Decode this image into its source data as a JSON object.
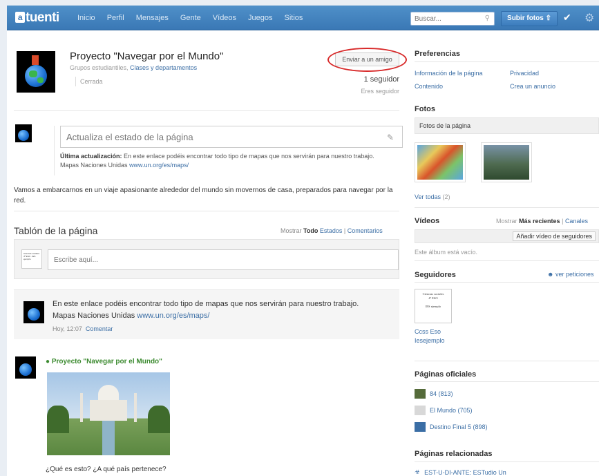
{
  "topbar": {
    "logo_box": "a",
    "logo_text": "tuenti",
    "nav": [
      "Inicio",
      "Perfil",
      "Mensajes",
      "Gente",
      "Vídeos",
      "Juegos",
      "Sitios"
    ],
    "search_placeholder": "Buscar...",
    "upload_label": "Subir fotos ⇧",
    "check_glyph": "✔",
    "gear_glyph": "⚙"
  },
  "page": {
    "title": "Proyecto \"Navegar por el Mundo\"",
    "subtitle_prefix": "Grupos estudiantiles, ",
    "subtitle_link": "Clases y departamentos",
    "closed": "Cerrada",
    "send_button": "Enviar a un amigo",
    "followers": "1 seguidor",
    "is_follower": "Eres seguidor"
  },
  "status": {
    "placeholder": "Actualiza el estado de la página",
    "last_update_label": "Última actualización:",
    "last_update_text": " En este enlace podéis encontrar todo tipo de mapas que nos servirán para nuestro trabajo.",
    "last_update_line2": "Mapas Naciones Unidas ",
    "last_update_link": "www.un.org/es/maps/"
  },
  "description": "Vamos a embarcarnos en un viaje apasionante alrededor del mundo sin movernos de casa, preparados para navegar por la red.",
  "wall": {
    "title": "Tablón de la página",
    "filter_label": "Mostrar ",
    "filter_all": "Todo",
    "filter_states": "Estados",
    "filter_comments": "Comentarios",
    "input_placeholder": "Escribe aquí...",
    "mini_avatar_text": "Ciencias sociales 4º ESO · IES ejemplo"
  },
  "post1": {
    "text_line1": "En este enlace podéis encontrar todo tipo de mapas que nos servirán para nuestro trabajo.",
    "text_line2": "Mapas Naciones Unidas ",
    "link": "www.un.org/es/maps/",
    "time": "Hoy, 12:07",
    "comment": "Comentar"
  },
  "post2": {
    "author": "Proyecto \"Navegar por el Mundo\"",
    "question": "¿Qué es esto? ¿A qué país pertenece?"
  },
  "sidebar": {
    "prefs_title": "Preferencias",
    "prefs_links": [
      "Información de la página",
      "Privacidad",
      "Contenido",
      "Crea un anuncio"
    ],
    "photos_title": "Fotos",
    "photos_bar": "Fotos de la página",
    "see_all": "Ver todas",
    "see_all_count": " (2)",
    "videos_title": "Vídeos",
    "videos_show": "Mostrar ",
    "videos_recent": "Más recientes",
    "videos_channels": "Canales",
    "add_video": "Añadir vídeo de seguidores",
    "empty_album": "Este álbum está vacío.",
    "followers_title": "Seguidores",
    "see_requests": "ver peticiones",
    "follower_name": "Ccss Eso",
    "follower_name2": "Iesejemplo",
    "follower_card_l1": "Ciencias sociales",
    "follower_card_l2": "4º ESO",
    "follower_card_l3": "IES ejemplo",
    "official_title": "Páginas oficiales",
    "official_pages": [
      "84 (813)",
      "El Mundo (705)",
      "Destino Final 5 (898)"
    ],
    "related_title": "Páginas relacionadas",
    "related_item": "EST-U-DI-ANTE: ESTudio Un"
  }
}
